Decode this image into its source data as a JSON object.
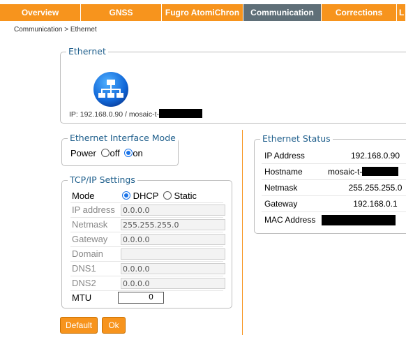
{
  "tabs": [
    {
      "label": "Overview"
    },
    {
      "label": "GNSS"
    },
    {
      "label": "Fugro AtomiChron"
    },
    {
      "label": "Communication"
    },
    {
      "label": "Corrections"
    },
    {
      "label": "L"
    }
  ],
  "breadcrumb": "Communication > Ethernet",
  "ethernet": {
    "legend": "Ethernet",
    "ip_text": "IP: 192.168.0.90 / mosaic-t-"
  },
  "interface_mode": {
    "legend": "Ethernet Interface Mode",
    "power_label": "Power",
    "off_label": "off",
    "on_label": "on"
  },
  "tcpip": {
    "legend": "TCP/IP Settings",
    "mode_label": "Mode",
    "dhcp_label": "DHCP",
    "static_label": "Static",
    "ip_label": "IP address",
    "ip_value": "0.0.0.0",
    "netmask_label": "Netmask",
    "netmask_value": "255.255.255.0",
    "gateway_label": "Gateway",
    "gateway_value": "0.0.0.0",
    "domain_label": "Domain",
    "domain_value": "",
    "dns1_label": "DNS1",
    "dns1_value": "0.0.0.0",
    "dns2_label": "DNS2",
    "dns2_value": "0.0.0.0",
    "mtu_label": "MTU",
    "mtu_value": "0"
  },
  "buttons": {
    "default_label": "Default",
    "ok_label": "Ok"
  },
  "status": {
    "legend": "Ethernet Status",
    "ip_label": "IP Address",
    "ip_value": "192.168.0.90",
    "hostname_label": "Hostname",
    "hostname_value": "mosaic-t-",
    "netmask_label": "Netmask",
    "netmask_value": "255.255.255.0",
    "gateway_label": "Gateway",
    "gateway_value": "192.168.0.1",
    "mac_label": "MAC Address"
  },
  "colors": {
    "tab_orange": "#f7941d",
    "tab_active": "#5f6f78",
    "legend_blue": "#1f5f8c"
  }
}
